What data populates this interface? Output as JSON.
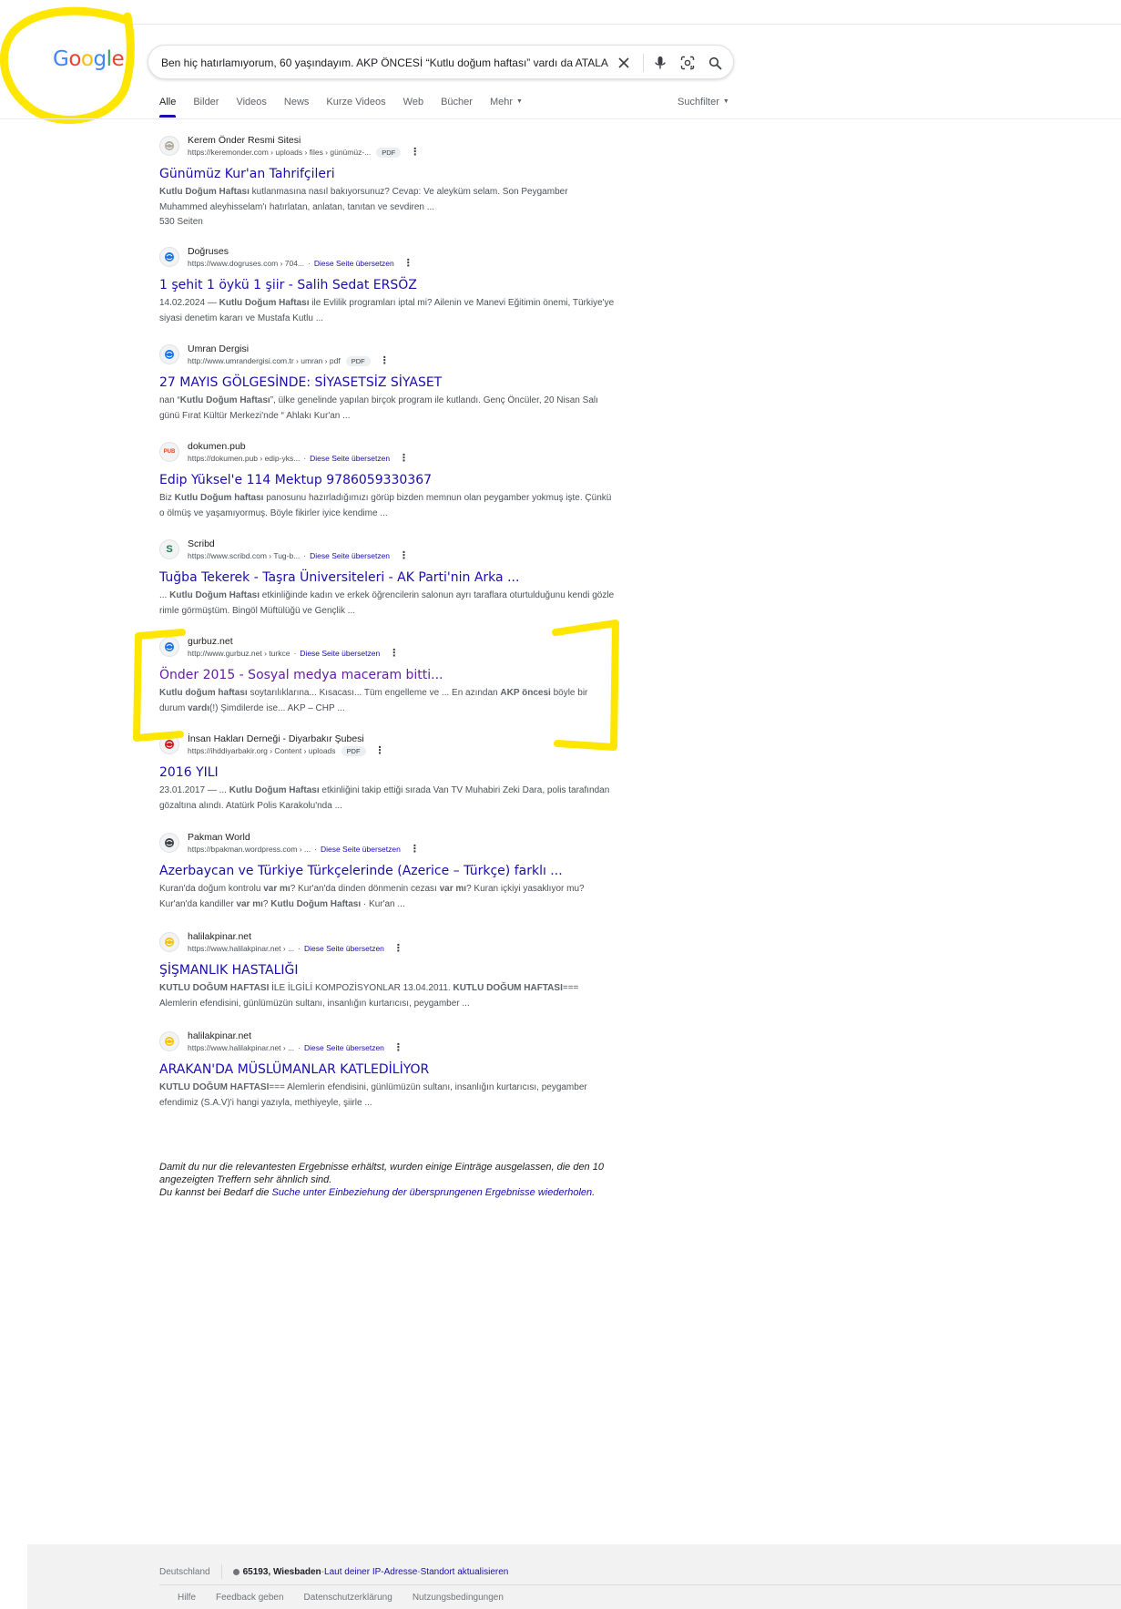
{
  "logo": {
    "letters": [
      "G",
      "o",
      "o",
      "g",
      "l",
      "e"
    ],
    "colors": [
      "#4285F4",
      "#EA4335",
      "#FBBC05",
      "#4285F4",
      "#34A853",
      "#EA4335"
    ]
  },
  "search": {
    "query": "Ben hiç hatırlamıyorum, 60 yaşındayım. AKP ÖNCESİ “Kutlu doğum haftası” vardı da ATALA"
  },
  "icons": {
    "clear": "close-icon",
    "voice": "mic-icon",
    "lens": "lens-icon",
    "search": "search-icon"
  },
  "tabs": [
    {
      "label": "Alle",
      "active": true
    },
    {
      "label": "Bilder"
    },
    {
      "label": "Videos"
    },
    {
      "label": "News"
    },
    {
      "label": "Kurze Videos"
    },
    {
      "label": "Web"
    },
    {
      "label": "Bücher"
    },
    {
      "label": "Mehr",
      "caret": true
    }
  ],
  "filter": {
    "label": "Suchfilter"
  },
  "translate_label": "Diese Seite übersetzen",
  "pdf_badge": "PDF",
  "results": [
    {
      "site": "Kerem Önder Resmi Sitesi",
      "url": "https://keremonder.com › uploads › files › günümüz-...",
      "pdf": true,
      "title": "Günümüz Kur'an Tahrifçileri",
      "snippet": [
        {
          "t": "Kutlu Doğum Haftası",
          "b": true
        },
        {
          "t": " kutlanmasına nasıl bakıyorsunuz? Cevap: Ve aleyküm selam. Son Peygamber Muhammed aleyhisselam'ı hatırlatan, anlatan, tanıtan ve sevdiren ..."
        }
      ],
      "pages": "530 Seiten",
      "accent": "#b0a99d"
    },
    {
      "site": "Doğruses",
      "url": "https://www.dogruses.com › 704...",
      "translate": true,
      "title": "1 şehit 1 öykü 1 şiir - Salih Sedat ERSÖZ",
      "snippet": [
        {
          "t": "14.02.2024 — "
        },
        {
          "t": "Kutlu Doğum Haftası",
          "b": true
        },
        {
          "t": " ile Evlilik programları iptal mi? Ailenin ve Manevi Eğitimin önemi, Türkiye'ye siyasi denetim kararı ve Mustafa Kutlu ..."
        }
      ],
      "accent": "#1a73e8"
    },
    {
      "site": "Umran Dergisi",
      "url": "http://www.umrandergisi.com.tr › umran › pdf",
      "pdf": true,
      "title": "27 MAYIS GÖLGESİNDE: SİYASETSİZ SİYASET",
      "snippet": [
        {
          "t": "nan “"
        },
        {
          "t": "Kutlu Doğum Haftası",
          "b": true
        },
        {
          "t": "”, ülke genelinde yapılan birçok program ile kutlandı. Genç Öncüler, 20 Nisan Salı günü Fırat Kültür Merkezi'nde “ Ahlakı Kur'an ..."
        }
      ],
      "accent": "#1a73e8"
    },
    {
      "site": "dokumen.pub",
      "url": "https://dokumen.pub › edip-yks...",
      "translate": true,
      "title": "Edip Yüksel'e 114 Mektup 9786059330367",
      "snippet": [
        {
          "t": "Biz "
        },
        {
          "t": "Kutlu Doğum haftası",
          "b": true
        },
        {
          "t": " panosunu hazırladığımızı görüp bizden memnun olan peygamber yokmuş işte. Çünkü o ölmüş ve yaşamıyormuş. Böyle fikirler iyice kendime ..."
        }
      ],
      "fav_text": "PUB",
      "accent": "#e8431f"
    },
    {
      "site": "Scribd",
      "url": "https://www.scribd.com › Tug-b...",
      "translate": true,
      "title": "Tuğba Tekerek - Taşra Üniversiteleri - AK Parti'nin Arka ...",
      "snippet": [
        {
          "t": "... "
        },
        {
          "t": "Kutlu Doğum Haftası",
          "b": true
        },
        {
          "t": " etkinliğinde kadın ve erkek öğrencilerin salonun ayrı taraflara oturtulduğunu kendi gözle rimle görmüştüm. Bingöl Müftülüğü ve Gençlik ..."
        }
      ],
      "fav_text": "S",
      "accent": "#1e7b4f"
    },
    {
      "site": "gurbuz.net",
      "url": "http://www.gurbuz.net › turkce",
      "translate": true,
      "visited": true,
      "title": "Önder 2015 - Sosyal medya maceram bitti...",
      "snippet": [
        {
          "t": "Kutlu doğum haftası",
          "b": true
        },
        {
          "t": " soytarılıklarına... Kısacası... Tüm engelleme ve ... En azından "
        },
        {
          "t": "AKP",
          "b": true
        },
        {
          "t": " öncesi",
          "b": true
        },
        {
          "t": " böyle bir durum "
        },
        {
          "t": "vardı",
          "b": true
        },
        {
          "t": "(!) Şimdilerde ise... AKP – CHP ..."
        }
      ],
      "accent": "#1a73e8"
    },
    {
      "site": "İnsan Hakları Derneği - Diyarbakır Şubesi",
      "url": "https://ihddiyarbakir.org › Content › uploads",
      "pdf": true,
      "title": "2016 YILI",
      "snippet": [
        {
          "t": "23.01.2017 — ... "
        },
        {
          "t": "Kutlu Doğum Haftası",
          "b": true
        },
        {
          "t": " etkinliğini takip ettiği sırada Van TV Muhabiri Zeki Dara, polis tarafından gözaltına alındı. Atatürk Polis Karakolu'nda ..."
        }
      ],
      "accent": "#c5221f"
    },
    {
      "site": "Pakman World",
      "url": "https://bpakman.wordpress.com › ...",
      "translate": true,
      "title": "Azerbaycan ve Türkiye Türkçelerinde (Azerice – Türkçe) farklı ...",
      "snippet": [
        {
          "t": "Kuran'da doğum kontrolu "
        },
        {
          "t": "var mı",
          "b": true
        },
        {
          "t": "? Kur'an'da dinden dönmenin cezası "
        },
        {
          "t": "var mı",
          "b": true
        },
        {
          "t": "? Kuran içkiyi yasaklıyor mu? Kur'an'da kandiller "
        },
        {
          "t": "var mı",
          "b": true
        },
        {
          "t": "? "
        },
        {
          "t": "Kutlu Doğum Haftası",
          "b": true
        },
        {
          "t": " · Kur'an ..."
        }
      ],
      "accent": "#3c4043"
    },
    {
      "site": "halilakpinar.net",
      "url": "https://www.halilakpinar.net › ...",
      "translate": true,
      "title": "ŞİŞMANLIK HASTALIĞI",
      "snippet": [
        {
          "t": "KUTLU DOĞUM HAFTASI",
          "b": true
        },
        {
          "t": " İLE İLGİLİ KOMPOZİSYONLAR 13.04.2011. "
        },
        {
          "t": "KUTLU DOĞUM HAFTASI",
          "b": true
        },
        {
          "t": "=== Alemlerin efendisini, günlümüzün sultanı, insanlığın kurtarıcısı, peygamber ..."
        }
      ],
      "accent": "#f4c20d"
    },
    {
      "site": "halilakpinar.net",
      "url": "https://www.halilakpinar.net › ...",
      "translate": true,
      "title": "ARAKAN'DA MÜSLÜMANLAR KATLEDİLİYOR",
      "snippet": [
        {
          "t": "KUTLU DOĞUM HAFTASI",
          "b": true
        },
        {
          "t": "=== Alemlerin efendisini, günlümüzün sultanı, insanlığın kurtarıcısı, peygamber efendimiz (S.A.V)'i hangi yazıyla, methiyeyle, şiirle ..."
        }
      ],
      "accent": "#f4c20d"
    }
  ],
  "omitted": {
    "line1": "Damit du nur die relevantesten Ergebnisse erhältst, wurden einige Einträge ausgelassen, die den 10 angezeigten Treffern sehr ähnlich sind.",
    "line2_prefix": "Du kannst bei Bedarf die ",
    "link": "Suche unter Einbeziehung der übersprungenen Ergebnisse wiederholen",
    "suffix": "."
  },
  "footer": {
    "country": "Deutschland",
    "location": "65193, Wiesbaden",
    "sep1": " - ",
    "ip_link": "Laut deiner IP-Adresse",
    "sep2": " - ",
    "update_link": "Standort aktualisieren",
    "links": [
      "Hilfe",
      "Feedback geben",
      "Datenschutzerklärung",
      "Nutzungsbedingungen"
    ]
  },
  "colors": {
    "link": "#1a0dab",
    "visited": "#681da8",
    "highlighter": "#ffe600"
  }
}
